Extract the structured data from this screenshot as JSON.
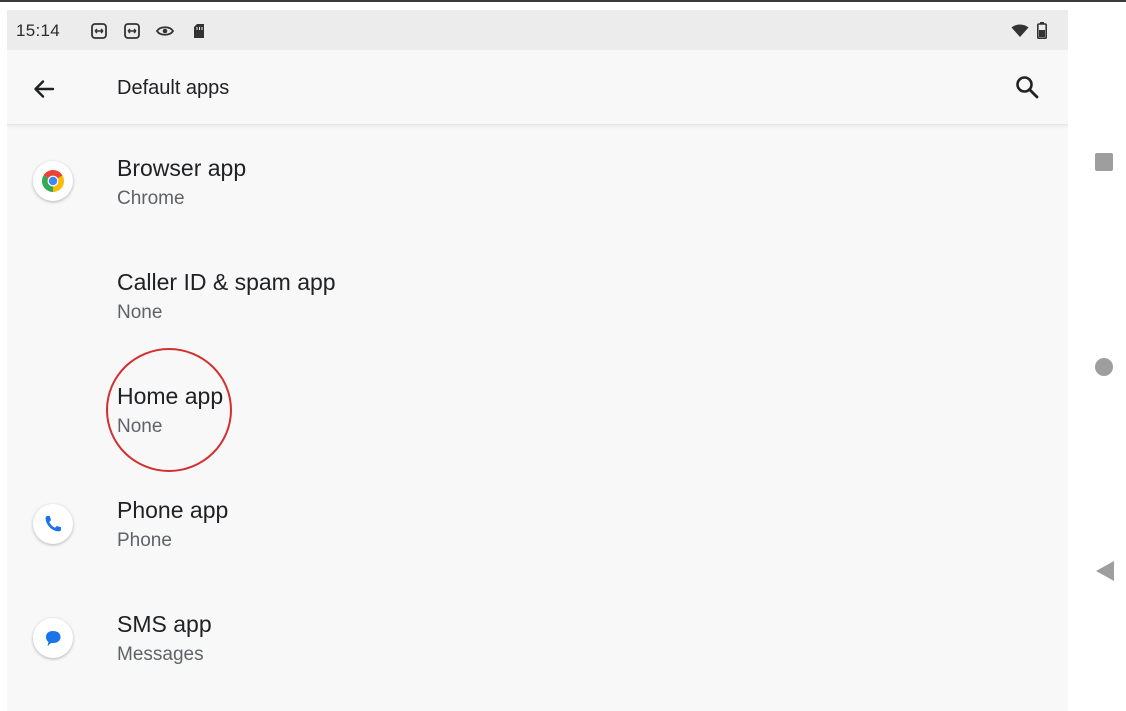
{
  "status_bar": {
    "time": "15:14",
    "left_icons": [
      "remote-control-icon",
      "remote-control-icon",
      "eye-icon",
      "sd-card-icon"
    ],
    "right_icons": [
      "wifi-icon",
      "battery-icon"
    ]
  },
  "app_bar": {
    "title": "Default apps",
    "back_icon": "back-arrow-icon",
    "search_icon": "search-icon"
  },
  "items": [
    {
      "title": "Browser app",
      "subtitle": "Chrome",
      "icon": "chrome-icon"
    },
    {
      "title": "Caller ID & spam app",
      "subtitle": "None",
      "icon": ""
    },
    {
      "title": "Home app",
      "subtitle": "None",
      "icon": ""
    },
    {
      "title": "Phone app",
      "subtitle": "Phone",
      "icon": "phone-icon"
    },
    {
      "title": "SMS app",
      "subtitle": "Messages",
      "icon": "messages-icon"
    }
  ],
  "annotation": {
    "color": "#d32f2f",
    "target": "Home app"
  },
  "nav_bar": {
    "buttons": [
      "recents-square-icon",
      "home-circle-icon",
      "back-triangle-icon"
    ]
  },
  "colors": {
    "background": "#f8f8f8",
    "status_bar": "#ececec",
    "text_primary": "#202124",
    "text_secondary": "#5f6368",
    "chrome_red": "#ea4335",
    "chrome_yellow": "#fbbc04",
    "chrome_green": "#34a853",
    "chrome_blue": "#4285f4",
    "phone_blue": "#1a73e8"
  }
}
